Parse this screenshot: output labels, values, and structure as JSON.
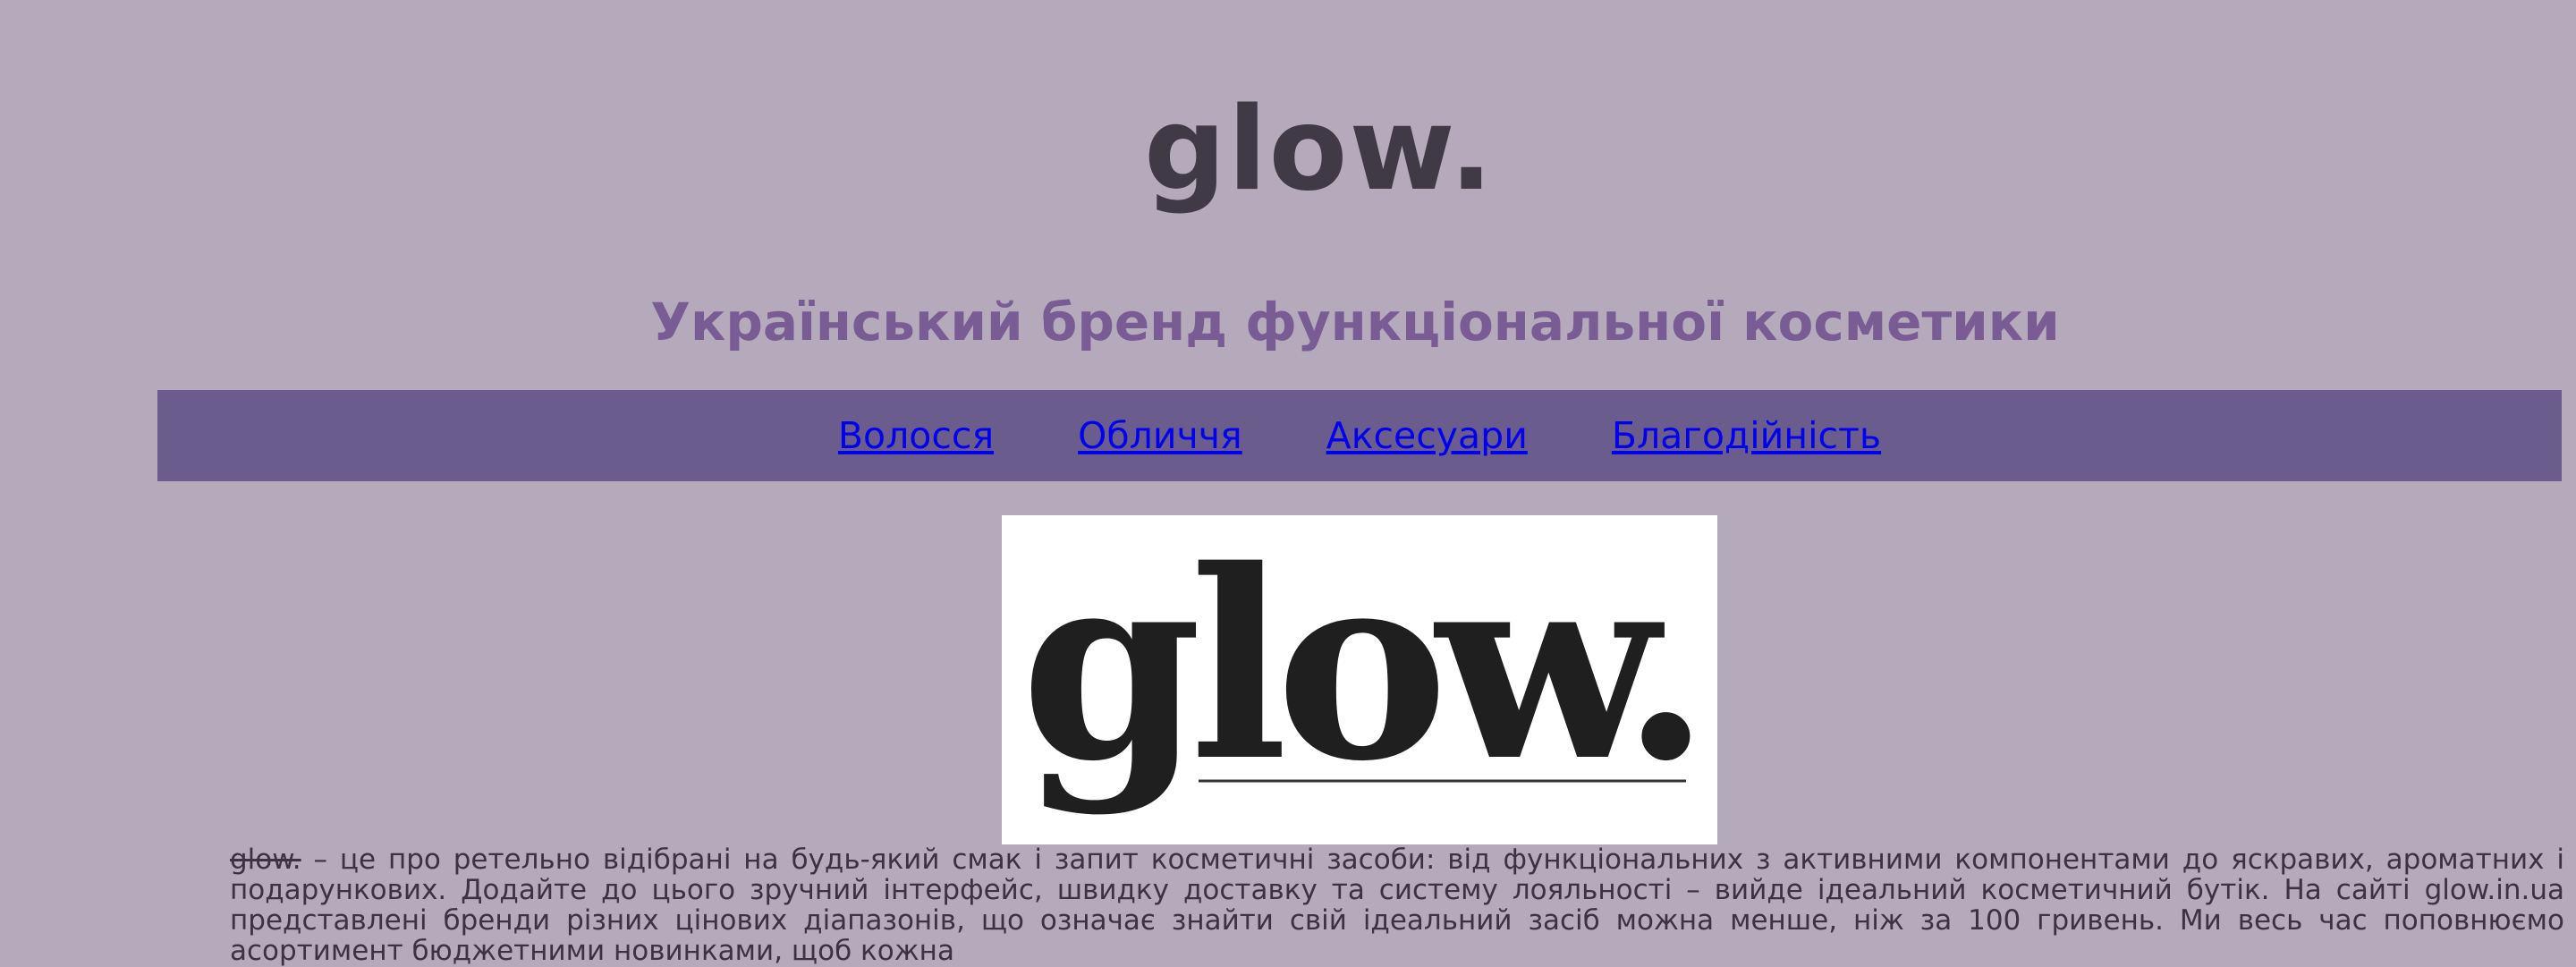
{
  "header": {
    "site_title": "glow.",
    "subtitle": "Український бренд функціональної косметики"
  },
  "nav": {
    "items": [
      {
        "label": "Волосся"
      },
      {
        "label": "Обличчя"
      },
      {
        "label": "Аксесуари"
      },
      {
        "label": "Благодійність"
      }
    ]
  },
  "logo": {
    "text": "glow."
  },
  "intro": {
    "brand": "glow.",
    "text": " – це про ретельно відібрані на будь-який смак і запит косметичні засоби: від функціональних з активними компонентами до яскравих, ароматних і подарункових. Додайте до цього зручний інтерфейс, швидку доставку та систему лояльності – вийде ідеальний косметичний бутік. На сайті glow.in.ua представлені бренди різних цінових діапазонів, що означає знайти свій ідеальний засіб можна менше, ніж за 100 гривень. Ми весь час поповнюємо асортимент бюджетними новинками, щоб кожна"
  },
  "colors": {
    "background": "#b5a9bc",
    "nav_background": "#6b5c8e",
    "title": "#3f3a45",
    "subtitle": "#7a5c95",
    "link": "#0000ee"
  }
}
